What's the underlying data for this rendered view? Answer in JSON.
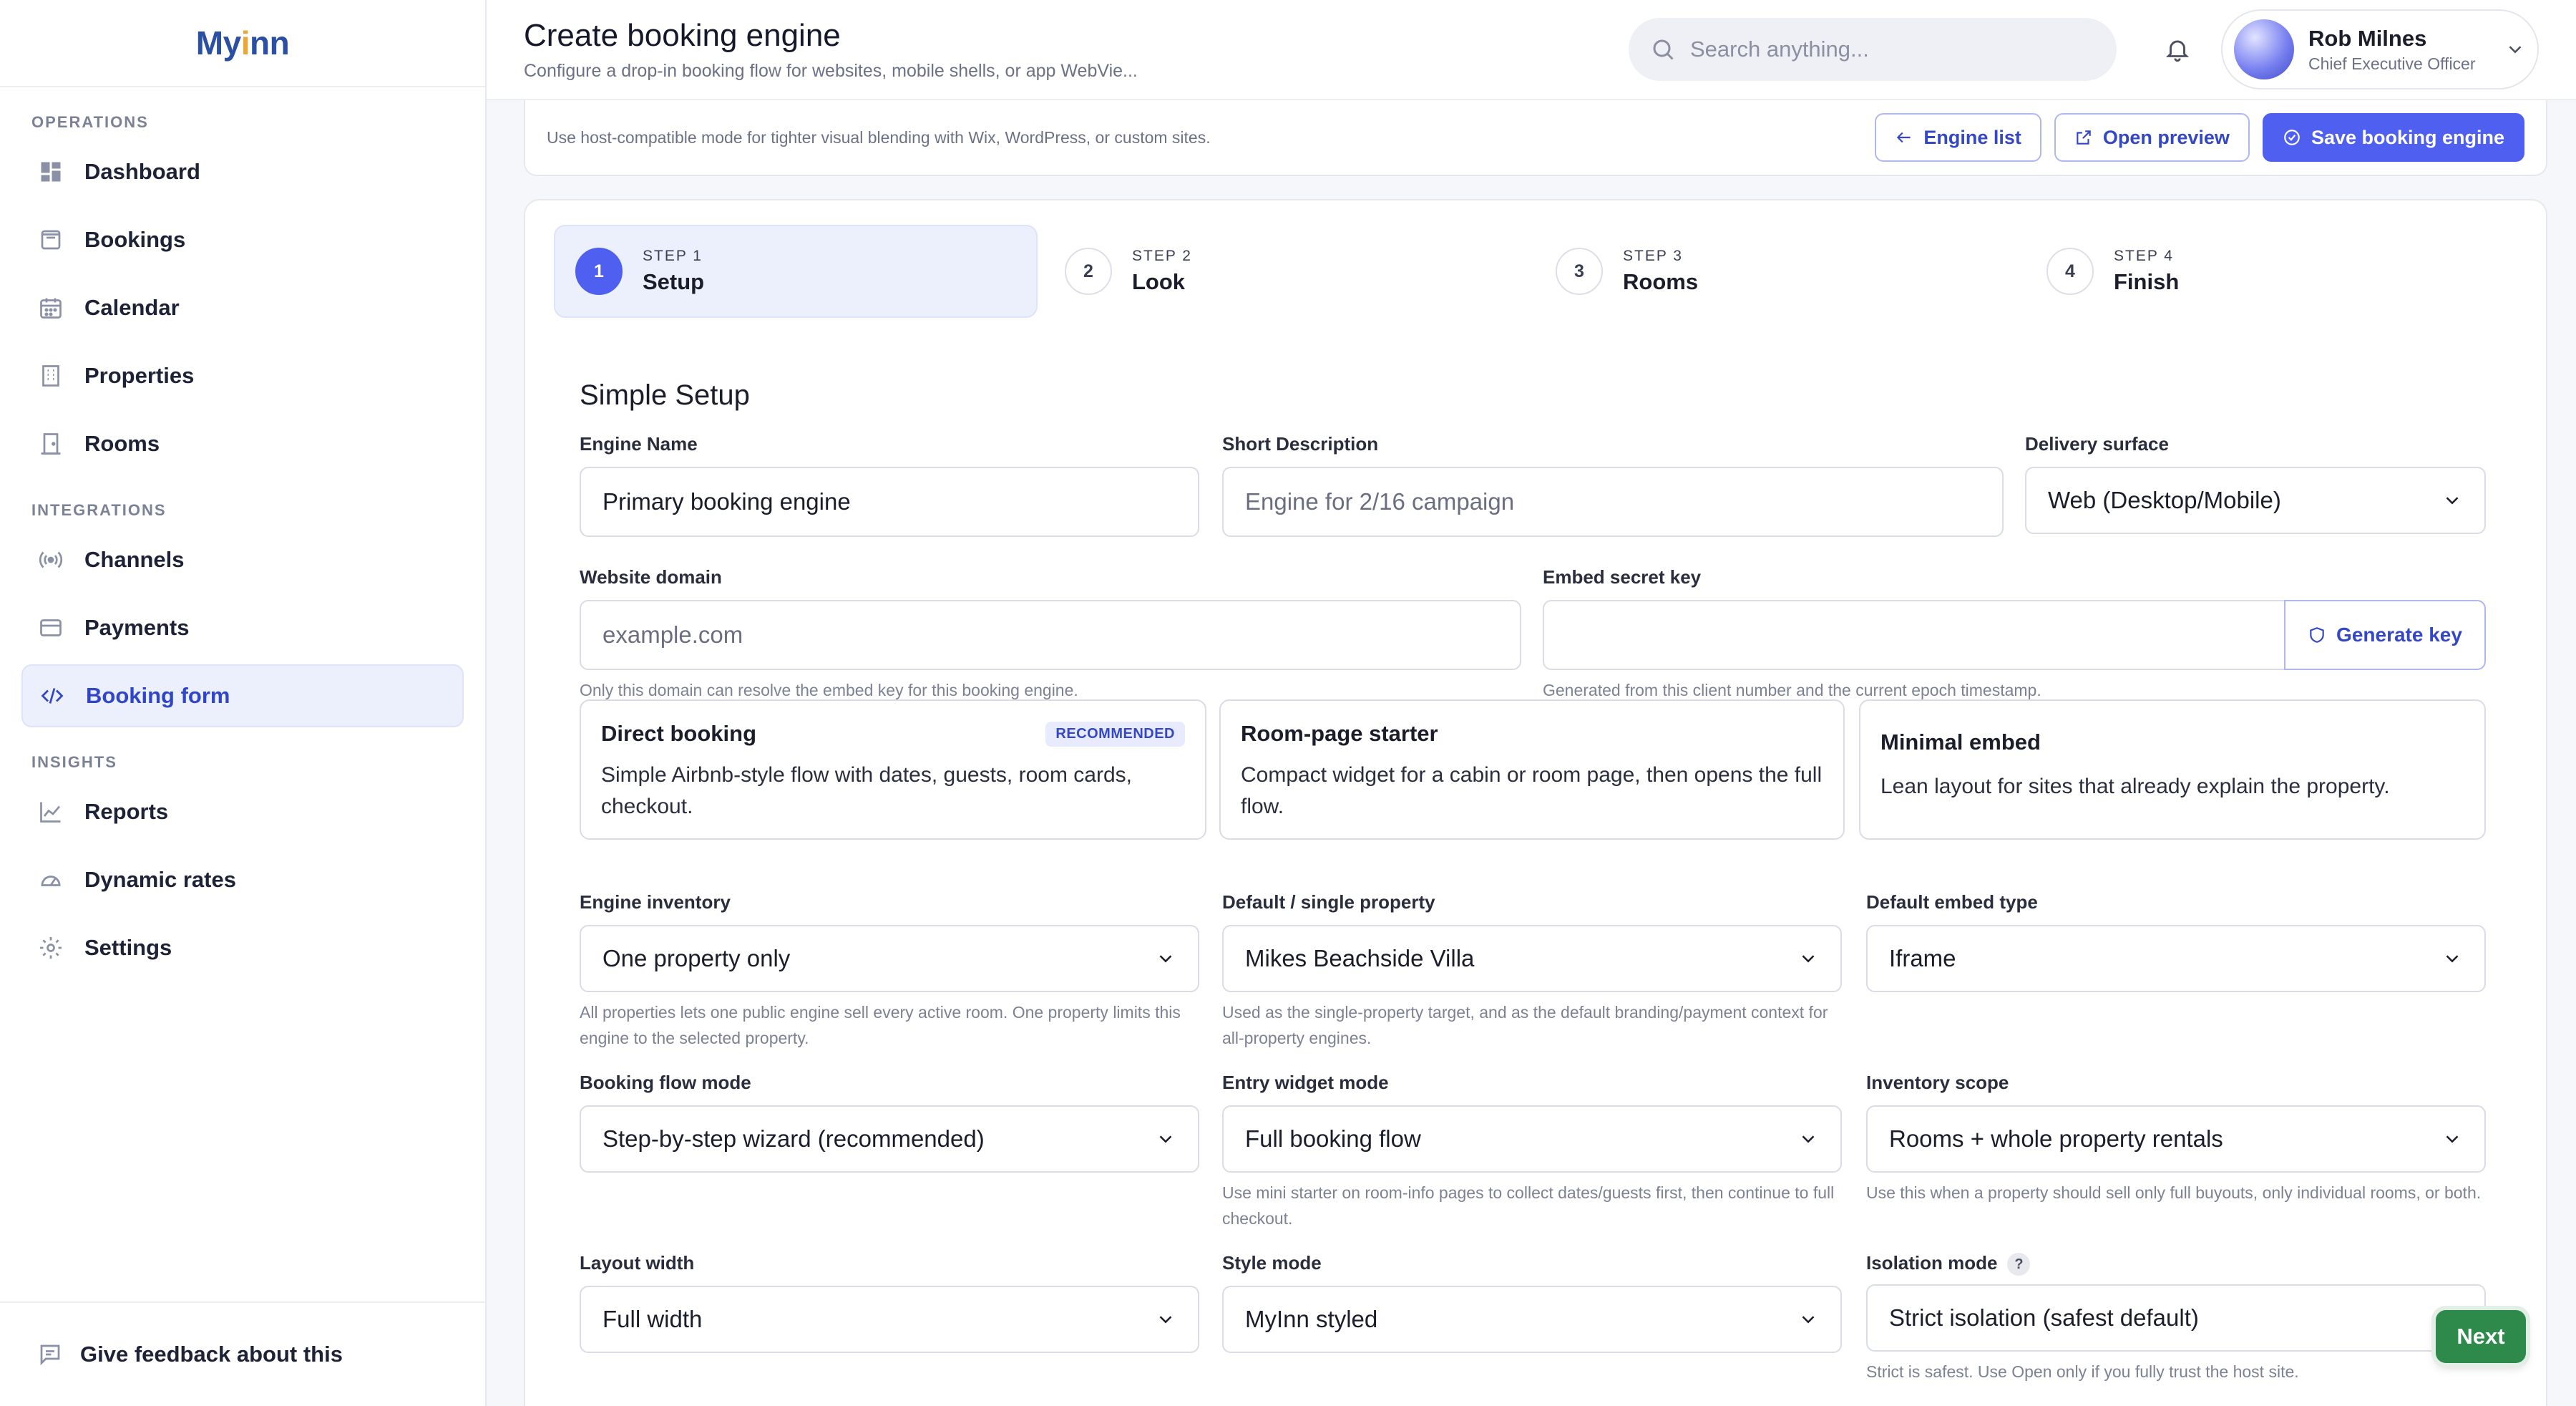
{
  "brand": {
    "name_pre": "My",
    "name_i": "i",
    "name_post": "nn"
  },
  "sidebar": {
    "sections": [
      {
        "title": "OPERATIONS",
        "items": [
          {
            "label": "Dashboard",
            "icon": "dashboard-icon"
          },
          {
            "label": "Bookings",
            "icon": "bookings-icon"
          },
          {
            "label": "Calendar",
            "icon": "calendar-icon"
          },
          {
            "label": "Properties",
            "icon": "properties-icon"
          },
          {
            "label": "Rooms",
            "icon": "rooms-icon"
          }
        ]
      },
      {
        "title": "INTEGRATIONS",
        "items": [
          {
            "label": "Channels",
            "icon": "channels-icon"
          },
          {
            "label": "Payments",
            "icon": "payments-icon"
          },
          {
            "label": "Booking form",
            "icon": "code-icon",
            "active": true
          }
        ]
      },
      {
        "title": "INSIGHTS",
        "items": [
          {
            "label": "Reports",
            "icon": "reports-icon"
          },
          {
            "label": "Dynamic rates",
            "icon": "gauge-icon"
          },
          {
            "label": "Settings",
            "icon": "gear-icon"
          }
        ]
      }
    ],
    "feedback_label": "Give feedback about this"
  },
  "header": {
    "title": "Create booking engine",
    "subtitle": "Configure a drop-in booking flow for websites, mobile shells, or app WebVie...",
    "search_placeholder": "Search anything...",
    "user_name": "Rob Milnes",
    "user_role": "Chief Executive Officer"
  },
  "notice": {
    "text": "Use host-compatible mode for tighter visual blending with Wix, WordPress, or custom sites.",
    "engine_list": "Engine list",
    "open_preview": "Open preview",
    "save": "Save booking engine"
  },
  "steps": [
    {
      "num": "1",
      "small": "STEP 1",
      "label": "Setup"
    },
    {
      "num": "2",
      "small": "STEP 2",
      "label": "Look"
    },
    {
      "num": "3",
      "small": "STEP 3",
      "label": "Rooms"
    },
    {
      "num": "4",
      "small": "STEP 4",
      "label": "Finish"
    }
  ],
  "form": {
    "section_title": "Simple Setup",
    "engine_name": {
      "label": "Engine Name",
      "value": "Primary booking engine"
    },
    "short_description": {
      "label": "Short Description",
      "placeholder": "Engine for 2/16 campaign"
    },
    "delivery_surface": {
      "label": "Delivery surface",
      "value": "Web (Desktop/Mobile)"
    },
    "website_domain": {
      "label": "Website domain",
      "placeholder": "example.com",
      "hint": "Only this domain can resolve the embed key for this booking engine."
    },
    "embed_secret": {
      "label": "Embed secret key",
      "value": "",
      "button": "Generate key",
      "hint": "Generated from this client number and the current epoch timestamp."
    },
    "presets": [
      {
        "title": "Direct booking",
        "badge": "RECOMMENDED",
        "desc": "Simple Airbnb-style flow with dates, guests, room cards, checkout."
      },
      {
        "title": "Room-page starter",
        "desc": "Compact widget for a cabin or room page, then opens the full flow."
      },
      {
        "title": "Minimal embed",
        "desc": "Lean layout for sites that already explain the property."
      }
    ],
    "engine_inventory": {
      "label": "Engine inventory",
      "value": "One property only",
      "hint": "All properties lets one public engine sell every active room. One property limits this engine to the selected property."
    },
    "default_property": {
      "label": "Default / single property",
      "value": "Mikes Beachside Villa",
      "hint": "Used as the single-property target, and as the default branding/payment context for all-property engines."
    },
    "default_embed_type": {
      "label": "Default embed type",
      "value": "Iframe"
    },
    "booking_flow_mode": {
      "label": "Booking flow mode",
      "value": "Step-by-step wizard (recommended)"
    },
    "entry_widget_mode": {
      "label": "Entry widget mode",
      "value": "Full booking flow",
      "hint": "Use mini starter on room-info pages to collect dates/guests first, then continue to full checkout."
    },
    "inventory_scope": {
      "label": "Inventory scope",
      "value": "Rooms + whole property rentals",
      "hint": "Use this when a property should sell only full buyouts, only individual rooms, or both."
    },
    "layout_width": {
      "label": "Layout width",
      "value": "Full width"
    },
    "style_mode": {
      "label": "Style mode",
      "value": "MyInn styled"
    },
    "isolation_mode": {
      "label": "Isolation mode",
      "help": "?",
      "value": "Strict isolation (safest default)",
      "hint": "Strict is safest. Use Open only if you fully trust the host site."
    }
  },
  "next_button": "Next",
  "colors": {
    "accent": "#4f5ff0",
    "next": "#2e8a4a"
  }
}
